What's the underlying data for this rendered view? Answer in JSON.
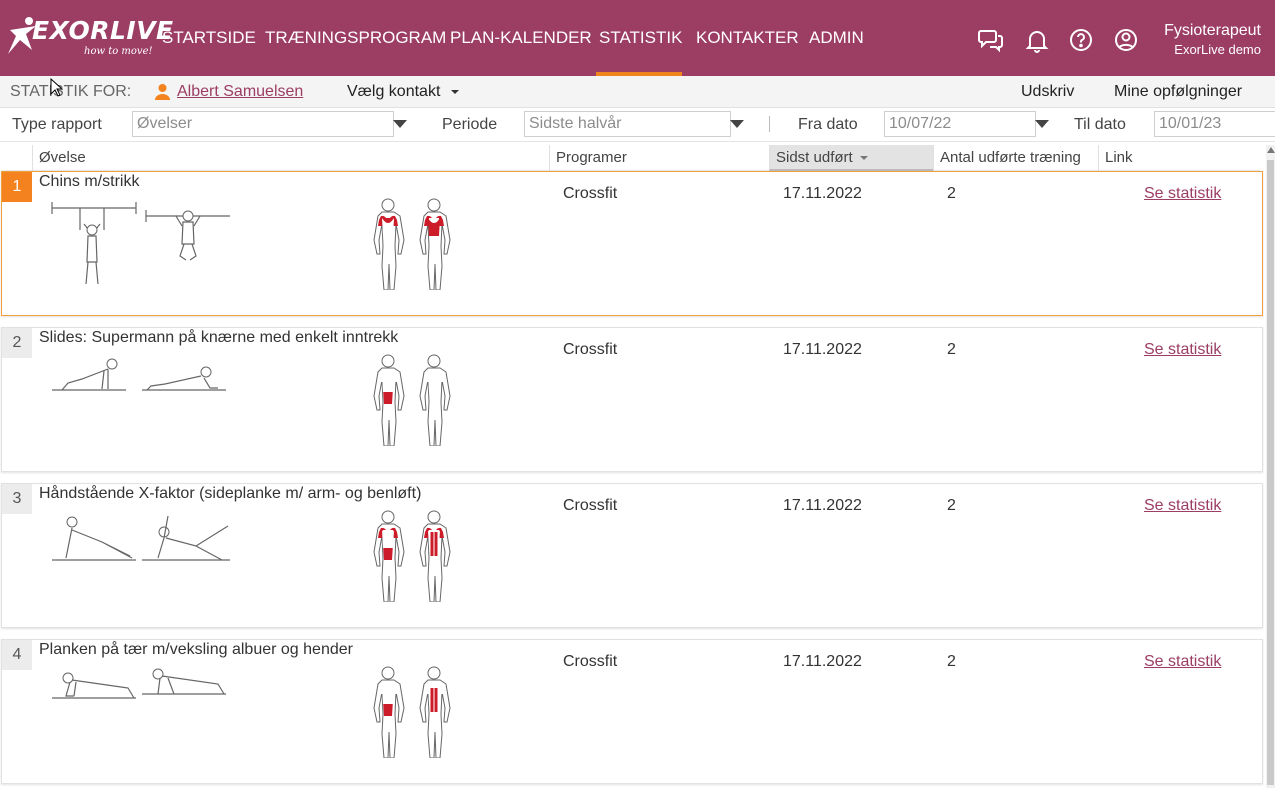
{
  "colors": {
    "brand": "#9c3d64",
    "accent": "#f4821f",
    "muscle": "#cc1c2a"
  },
  "logo": {
    "text": "EXORLIVE",
    "tagline": "how to move!"
  },
  "nav": {
    "items": [
      {
        "label": "STARTSIDE"
      },
      {
        "label": "TRÆNINGSPROGRAM"
      },
      {
        "label": "PLAN-KALENDER"
      },
      {
        "label": "STATISTIK",
        "active": true
      },
      {
        "label": "KONTAKTER"
      },
      {
        "label": "ADMIN"
      }
    ]
  },
  "header_icons": [
    "chat-icon",
    "bell-icon",
    "help-icon",
    "account-icon"
  ],
  "user": {
    "name": "Fysioterapeut",
    "org": "ExorLive demo"
  },
  "stat_bar": {
    "label": "STATISTIK FOR:",
    "contact_name": "Albert Samuelsen",
    "choose_contact": "Vælg kontakt",
    "print": "Udskriv",
    "followups": "Mine opfølgninger"
  },
  "filters": {
    "report_type_label": "Type rapport",
    "report_type_value": "Øvelser",
    "period_label": "Periode",
    "period_value": "Sidste halvår",
    "from_label": "Fra dato",
    "from_value": "10/07/22",
    "to_label": "Til dato",
    "to_value": "10/01/23"
  },
  "table": {
    "columns": [
      "Øvelse",
      "Programer",
      "Sidst udført",
      "Antal udførte træning",
      "Link"
    ],
    "sorted_column": "Sidst udført",
    "rows": [
      {
        "num": "1",
        "title": "Chins m/strikk",
        "program": "Crossfit",
        "last": "17.11.2022",
        "count": "2",
        "link": "Se statistik",
        "selected": true,
        "muscles": "back"
      },
      {
        "num": "2",
        "title": "Slides: Supermann på knærne med enkelt inntrekk",
        "program": "Crossfit",
        "last": "17.11.2022",
        "count": "2",
        "link": "Se statistik",
        "selected": false,
        "muscles": "abs"
      },
      {
        "num": "3",
        "title": "Håndstående X-faktor (sideplanke m/ arm- og benløft)",
        "program": "Crossfit",
        "last": "17.11.2022",
        "count": "2",
        "link": "Se statistik",
        "selected": false,
        "muscles": "full"
      },
      {
        "num": "4",
        "title": "Planken på tær m/veksling albuer og hender",
        "program": "Crossfit",
        "last": "17.11.2022",
        "count": "2",
        "link": "Se statistik",
        "selected": false,
        "muscles": "core"
      }
    ]
  }
}
